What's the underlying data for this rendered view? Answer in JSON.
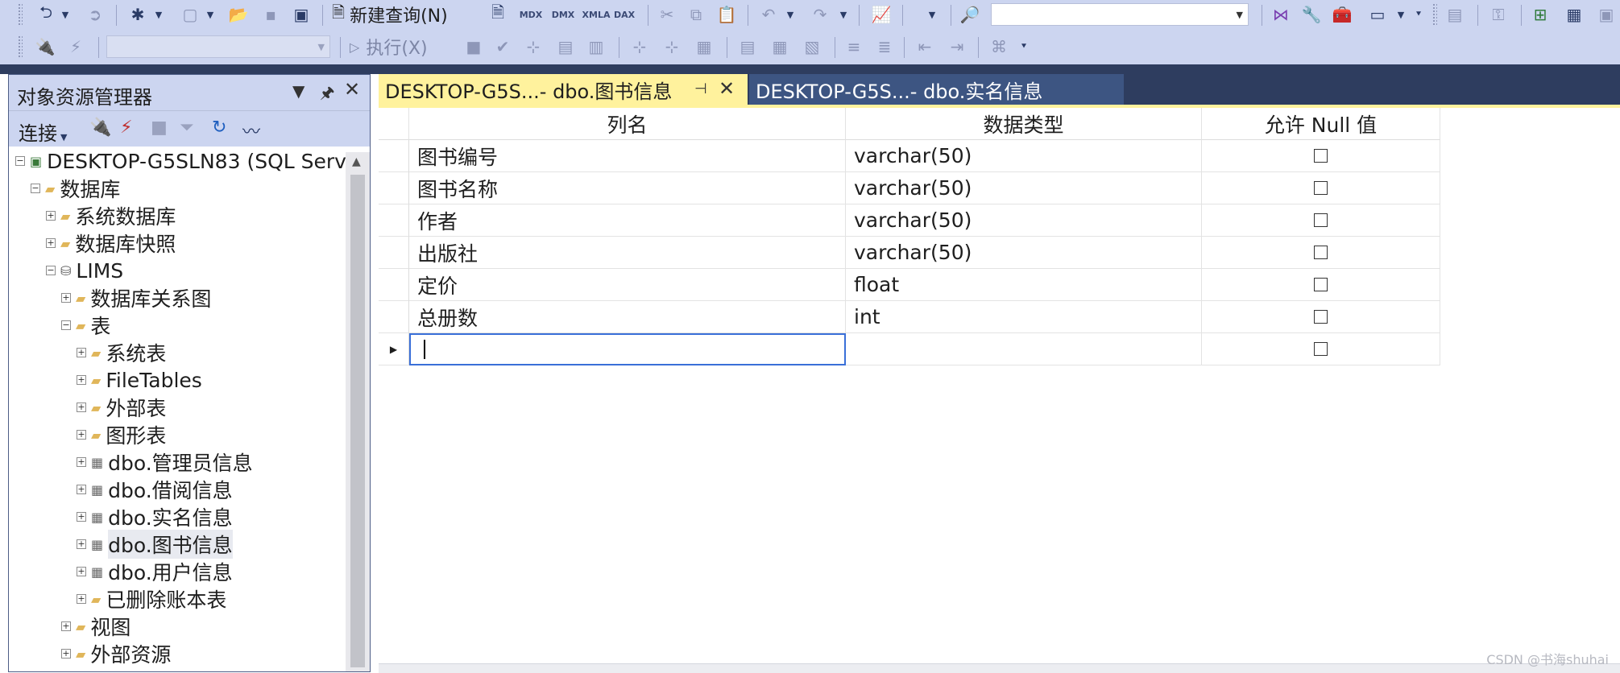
{
  "toolbar": {
    "new_query": "新建查询(N)",
    "mdx": "MDX",
    "dmx": "DMX",
    "xmla": "XMLA",
    "dax": "DAX",
    "execute": "执行(X)"
  },
  "object_explorer": {
    "title": "对象资源管理器",
    "connect": "连接",
    "tree": [
      {
        "label": "DESKTOP-G5SLN83 (SQL Serve",
        "level": 0,
        "expander": "−",
        "icon": "server"
      },
      {
        "label": "数据库",
        "level": 1,
        "expander": "−",
        "icon": "folder"
      },
      {
        "label": "系统数据库",
        "level": 2,
        "expander": "+",
        "icon": "folder"
      },
      {
        "label": "数据库快照",
        "level": 2,
        "expander": "+",
        "icon": "folder"
      },
      {
        "label": "LIMS",
        "level": 2,
        "expander": "−",
        "icon": "database"
      },
      {
        "label": "数据库关系图",
        "level": 3,
        "expander": "+",
        "icon": "folder"
      },
      {
        "label": "表",
        "level": 3,
        "expander": "−",
        "icon": "folder"
      },
      {
        "label": "系统表",
        "level": 4,
        "expander": "+",
        "icon": "folder"
      },
      {
        "label": "FileTables",
        "level": 4,
        "expander": "+",
        "icon": "folder"
      },
      {
        "label": "外部表",
        "level": 4,
        "expander": "+",
        "icon": "folder"
      },
      {
        "label": "图形表",
        "level": 4,
        "expander": "+",
        "icon": "folder"
      },
      {
        "label": "dbo.管理员信息",
        "level": 4,
        "expander": "+",
        "icon": "table"
      },
      {
        "label": "dbo.借阅信息",
        "level": 4,
        "expander": "+",
        "icon": "table"
      },
      {
        "label": "dbo.实名信息",
        "level": 4,
        "expander": "+",
        "icon": "table"
      },
      {
        "label": "dbo.图书信息",
        "level": 4,
        "expander": "+",
        "icon": "table",
        "selected": true
      },
      {
        "label": "dbo.用户信息",
        "level": 4,
        "expander": "+",
        "icon": "table"
      },
      {
        "label": "已删除账本表",
        "level": 4,
        "expander": "+",
        "icon": "folder"
      },
      {
        "label": "视图",
        "level": 3,
        "expander": "+",
        "icon": "folder"
      },
      {
        "label": "外部资源",
        "level": 3,
        "expander": "+",
        "icon": "folder"
      }
    ]
  },
  "tabs": [
    {
      "label": "DESKTOP-G5S...- dbo.图书信息",
      "active": true
    },
    {
      "label": "DESKTOP-G5S...- dbo.实名信息",
      "active": false
    }
  ],
  "designer": {
    "headers": [
      "列名",
      "数据类型",
      "允许 Null 值"
    ],
    "rows": [
      {
        "name": "图书编号",
        "type": "varchar(50)",
        "allow_null": false
      },
      {
        "name": "图书名称",
        "type": "varchar(50)",
        "allow_null": false
      },
      {
        "name": "作者",
        "type": "varchar(50)",
        "allow_null": false
      },
      {
        "name": "出版社",
        "type": "varchar(50)",
        "allow_null": false
      },
      {
        "name": "定价",
        "type": "float",
        "allow_null": false
      },
      {
        "name": "总册数",
        "type": "int",
        "allow_null": false
      },
      {
        "name": "",
        "type": "",
        "allow_null": false,
        "editing": true
      }
    ]
  },
  "watermark": "CSDN @书海shuhai"
}
